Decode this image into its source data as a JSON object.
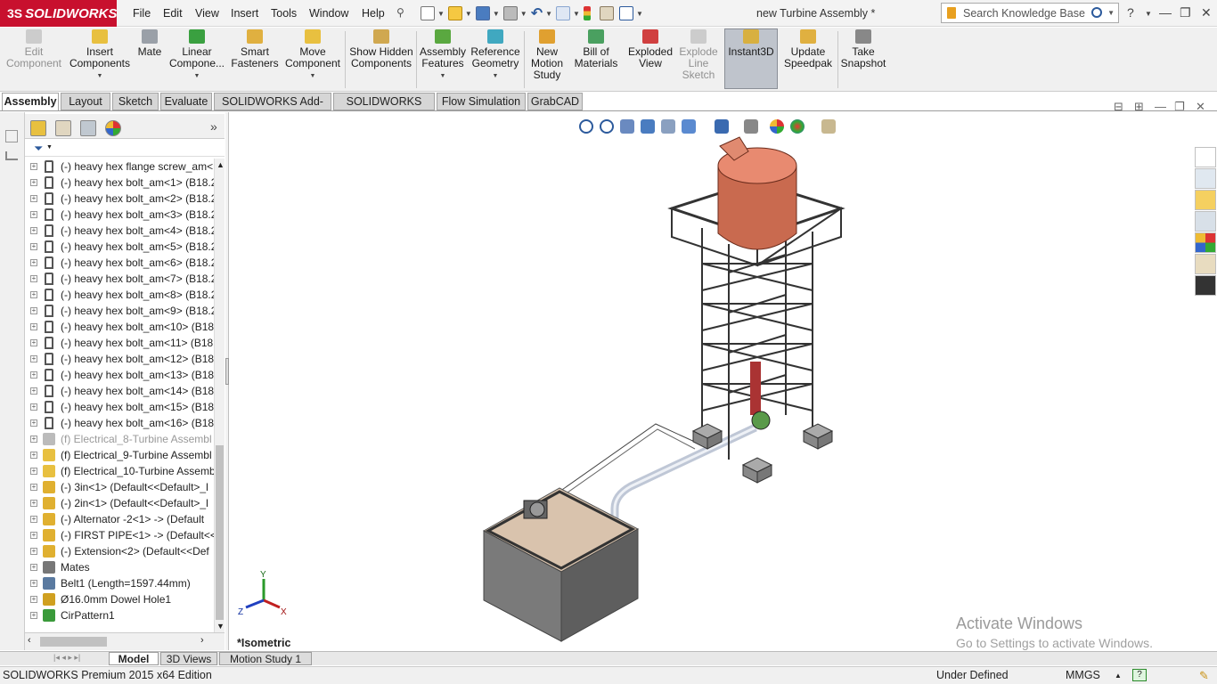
{
  "app": {
    "logo_prefix": "3S",
    "logo_text": "SOLIDWORKS",
    "document_title": "new Turbine Assembly *"
  },
  "menu": [
    "File",
    "Edit",
    "View",
    "Insert",
    "Tools",
    "Window",
    "Help"
  ],
  "search": {
    "placeholder": "Search Knowledge Base"
  },
  "ribbon": [
    {
      "label": "Edit Component",
      "disabled": true
    },
    {
      "label": "Insert Components"
    },
    {
      "label": "Mate"
    },
    {
      "label": "Linear Compone..."
    },
    {
      "label": "Smart Fasteners"
    },
    {
      "label": "Move Component"
    },
    {
      "label": "Show Hidden Components"
    },
    {
      "label": "Assembly Features"
    },
    {
      "label": "Reference Geometry"
    },
    {
      "label": "New Motion Study"
    },
    {
      "label": "Bill of Materials"
    },
    {
      "label": "Exploded View"
    },
    {
      "label": "Explode Line Sketch",
      "disabled": true
    },
    {
      "label": "Instant3D",
      "selected": true
    },
    {
      "label": "Update Speedpak"
    },
    {
      "label": "Take Snapshot"
    }
  ],
  "command_tabs": [
    "Assembly",
    "Layout",
    "Sketch",
    "Evaluate",
    "SOLIDWORKS Add-Ins",
    "SOLIDWORKS MBD",
    "Flow Simulation",
    "GrabCAD"
  ],
  "tree_items": [
    {
      "label": "(-) heavy hex flange screw_am<",
      "icon": "bolt-icon"
    },
    {
      "label": "(-) heavy hex bolt_am<1> (B18.2",
      "icon": "bolt-icon"
    },
    {
      "label": "(-) heavy hex bolt_am<2> (B18.2",
      "icon": "bolt-icon"
    },
    {
      "label": "(-) heavy hex bolt_am<3> (B18.2",
      "icon": "bolt-icon"
    },
    {
      "label": "(-) heavy hex bolt_am<4> (B18.2",
      "icon": "bolt-icon"
    },
    {
      "label": "(-) heavy hex bolt_am<5> (B18.2",
      "icon": "bolt-icon"
    },
    {
      "label": "(-) heavy hex bolt_am<6> (B18.2",
      "icon": "bolt-icon"
    },
    {
      "label": "(-) heavy hex bolt_am<7> (B18.2",
      "icon": "bolt-icon"
    },
    {
      "label": "(-) heavy hex bolt_am<8> (B18.2",
      "icon": "bolt-icon"
    },
    {
      "label": "(-) heavy hex bolt_am<9> (B18.2",
      "icon": "bolt-icon"
    },
    {
      "label": "(-) heavy hex bolt_am<10> (B18",
      "icon": "bolt-icon"
    },
    {
      "label": "(-) heavy hex bolt_am<11> (B18",
      "icon": "bolt-icon"
    },
    {
      "label": "(-) heavy hex bolt_am<12> (B18",
      "icon": "bolt-icon"
    },
    {
      "label": "(-) heavy hex bolt_am<13> (B18",
      "icon": "bolt-icon"
    },
    {
      "label": "(-) heavy hex bolt_am<14> (B18",
      "icon": "bolt-icon"
    },
    {
      "label": "(-) heavy hex bolt_am<15> (B18",
      "icon": "bolt-icon"
    },
    {
      "label": "(-) heavy hex bolt_am<16> (B18",
      "icon": "bolt-icon"
    },
    {
      "label": "(f) Electrical_8-Turbine Assembl",
      "icon": "subassembly-icon",
      "dim": true
    },
    {
      "label": "(f) Electrical_9-Turbine Assembl",
      "icon": "subassembly-icon"
    },
    {
      "label": "(f) Electrical_10-Turbine Assemb",
      "icon": "subassembly-icon"
    },
    {
      "label": "(-) 3in<1> (Default<<Default>_l",
      "icon": "part-icon"
    },
    {
      "label": "(-) 2in<1> (Default<<Default>_l",
      "icon": "part-icon"
    },
    {
      "label": "(-) Alternator -2<1> -> (Default",
      "icon": "part-icon"
    },
    {
      "label": "(-) FIRST PIPE<1> -> (Default<<",
      "icon": "part-icon"
    },
    {
      "label": "(-) Extension<2> (Default<<Def",
      "icon": "part-icon"
    },
    {
      "label": "Mates",
      "icon": "mates-icon"
    },
    {
      "label": "Belt1 (Length=1597.44mm)",
      "icon": "belt-icon"
    },
    {
      "label": "Ø16.0mm Dowel Hole1",
      "icon": "hole-icon"
    },
    {
      "label": "CirPattern1",
      "icon": "pattern-icon"
    }
  ],
  "view": {
    "orientation": "*Isometric",
    "triad": {
      "x": "X",
      "y": "Y",
      "z": "Z"
    }
  },
  "bottom_tabs": [
    "Model",
    "3D Views",
    "Motion Study 1"
  ],
  "status": {
    "edition": "SOLIDWORKS Premium 2015 x64 Edition",
    "state": "Under Defined",
    "units": "MMGS"
  },
  "watermark": {
    "line1": "Activate Windows",
    "line2": "Go to Settings to activate Windows."
  }
}
